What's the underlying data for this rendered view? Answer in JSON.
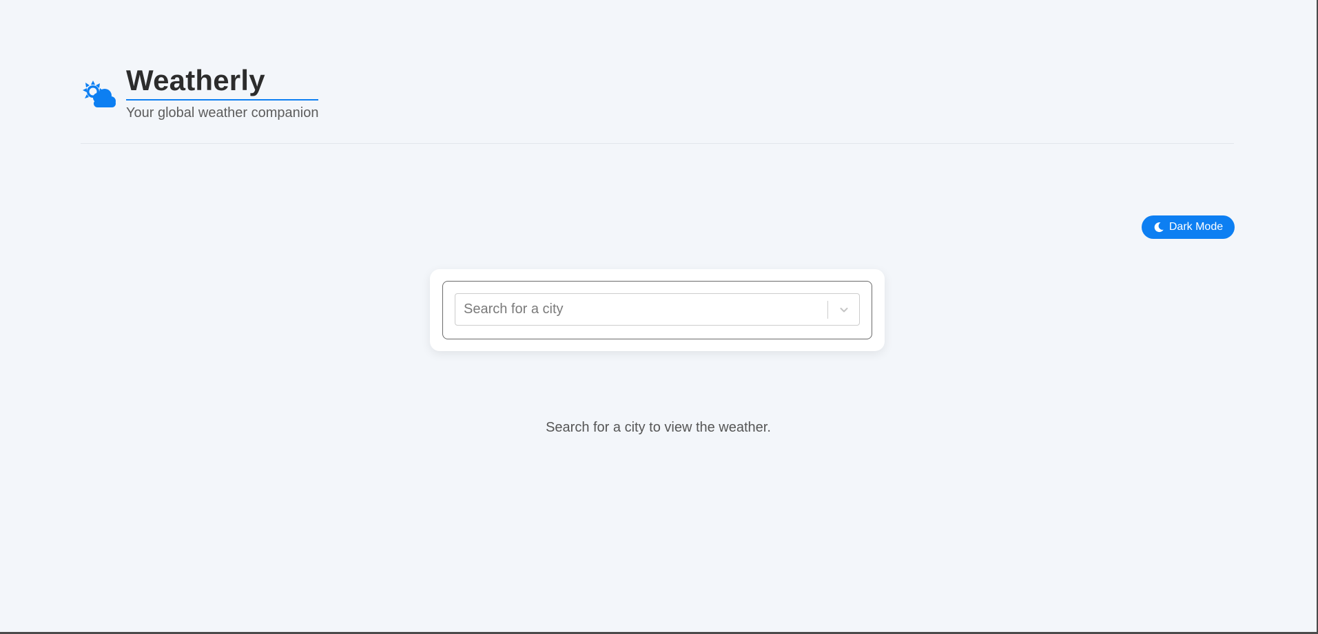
{
  "app": {
    "title": "Weatherly",
    "subtitle": "Your global weather companion",
    "logo_icon": "sun-cloud-icon",
    "accent_color": "#0d7ff2"
  },
  "toolbar": {
    "dark_mode_label": "Dark Mode",
    "dark_mode_icon": "moon-icon"
  },
  "search": {
    "placeholder": "Search for a city",
    "value": "",
    "dropdown_icon": "chevron-down-icon"
  },
  "main": {
    "empty_message": "Search for a city to view the weather."
  }
}
